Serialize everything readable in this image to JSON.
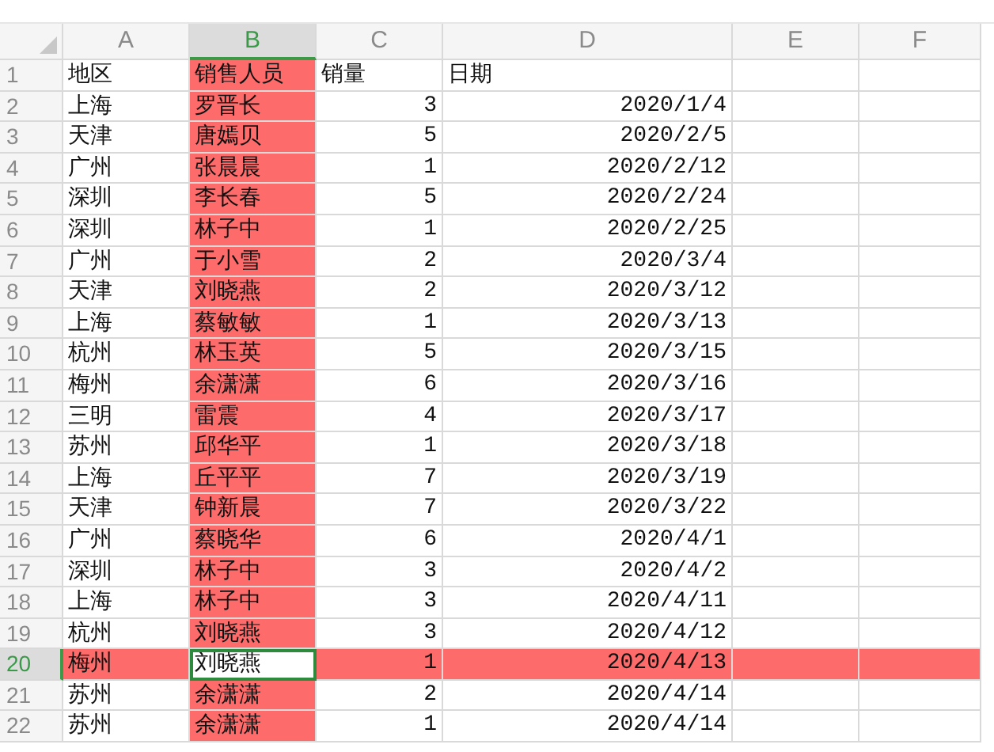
{
  "columns": [
    {
      "label": "A",
      "kind": "text",
      "selected": false,
      "highlighted": false
    },
    {
      "label": "B",
      "kind": "text",
      "selected": true,
      "highlighted": true
    },
    {
      "label": "C",
      "kind": "number",
      "selected": false,
      "highlighted": false
    },
    {
      "label": "D",
      "kind": "number",
      "selected": false,
      "highlighted": false
    },
    {
      "label": "E",
      "kind": "text",
      "selected": false,
      "highlighted": false
    },
    {
      "label": "F",
      "kind": "text",
      "selected": false,
      "highlighted": false
    }
  ],
  "rows": [
    {
      "number": "1",
      "kind": "header",
      "selected": false,
      "highlighted": false,
      "cells": [
        "地区",
        "销售人员",
        "销量",
        "日期"
      ]
    },
    {
      "number": "2",
      "kind": "data",
      "selected": false,
      "highlighted": false,
      "cells": [
        "上海",
        "罗晋长",
        "3",
        "2020/1/4"
      ]
    },
    {
      "number": "3",
      "kind": "data",
      "selected": false,
      "highlighted": false,
      "cells": [
        "天津",
        "唐嫣贝",
        "5",
        "2020/2/5"
      ]
    },
    {
      "number": "4",
      "kind": "data",
      "selected": false,
      "highlighted": false,
      "cells": [
        "广州",
        "张晨晨",
        "1",
        "2020/2/12"
      ]
    },
    {
      "number": "5",
      "kind": "data",
      "selected": false,
      "highlighted": false,
      "cells": [
        "深圳",
        "李长春",
        "5",
        "2020/2/24"
      ]
    },
    {
      "number": "6",
      "kind": "data",
      "selected": false,
      "highlighted": false,
      "cells": [
        "深圳",
        "林子中",
        "1",
        "2020/2/25"
      ]
    },
    {
      "number": "7",
      "kind": "data",
      "selected": false,
      "highlighted": false,
      "cells": [
        "广州",
        "于小雪",
        "2",
        "2020/3/4"
      ]
    },
    {
      "number": "8",
      "kind": "data",
      "selected": false,
      "highlighted": false,
      "cells": [
        "天津",
        "刘晓燕",
        "2",
        "2020/3/12"
      ]
    },
    {
      "number": "9",
      "kind": "data",
      "selected": false,
      "highlighted": false,
      "cells": [
        "上海",
        "蔡敏敏",
        "1",
        "2020/3/13"
      ]
    },
    {
      "number": "10",
      "kind": "data",
      "selected": false,
      "highlighted": false,
      "cells": [
        "杭州",
        "林玉英",
        "5",
        "2020/3/15"
      ]
    },
    {
      "number": "11",
      "kind": "data",
      "selected": false,
      "highlighted": false,
      "cells": [
        "梅州",
        "余潇潇",
        "6",
        "2020/3/16"
      ]
    },
    {
      "number": "12",
      "kind": "data",
      "selected": false,
      "highlighted": false,
      "cells": [
        "三明",
        "雷震",
        "4",
        "2020/3/17"
      ]
    },
    {
      "number": "13",
      "kind": "data",
      "selected": false,
      "highlighted": false,
      "cells": [
        "苏州",
        "邱华平",
        "1",
        "2020/3/18"
      ]
    },
    {
      "number": "14",
      "kind": "data",
      "selected": false,
      "highlighted": false,
      "cells": [
        "上海",
        "丘平平",
        "7",
        "2020/3/19"
      ]
    },
    {
      "number": "15",
      "kind": "data",
      "selected": false,
      "highlighted": false,
      "cells": [
        "天津",
        "钟新晨",
        "7",
        "2020/3/22"
      ]
    },
    {
      "number": "16",
      "kind": "data",
      "selected": false,
      "highlighted": false,
      "cells": [
        "广州",
        "蔡晓华",
        "6",
        "2020/4/1"
      ]
    },
    {
      "number": "17",
      "kind": "data",
      "selected": false,
      "highlighted": false,
      "cells": [
        "深圳",
        "林子中",
        "3",
        "2020/4/2"
      ]
    },
    {
      "number": "18",
      "kind": "data",
      "selected": false,
      "highlighted": false,
      "cells": [
        "上海",
        "林子中",
        "3",
        "2020/4/11"
      ]
    },
    {
      "number": "19",
      "kind": "data",
      "selected": false,
      "highlighted": false,
      "cells": [
        "杭州",
        "刘晓燕",
        "3",
        "2020/4/12"
      ]
    },
    {
      "number": "20",
      "kind": "data",
      "selected": true,
      "highlighted": true,
      "cells": [
        "梅州",
        "刘晓燕",
        "1",
        "2020/4/13"
      ]
    },
    {
      "number": "21",
      "kind": "data",
      "selected": false,
      "highlighted": false,
      "cells": [
        "苏州",
        "余潇潇",
        "2",
        "2020/4/14"
      ]
    },
    {
      "number": "22",
      "kind": "data",
      "selected": false,
      "highlighted": false,
      "cells": [
        "苏州",
        "余潇潇",
        "1",
        "2020/4/14"
      ]
    }
  ]
}
